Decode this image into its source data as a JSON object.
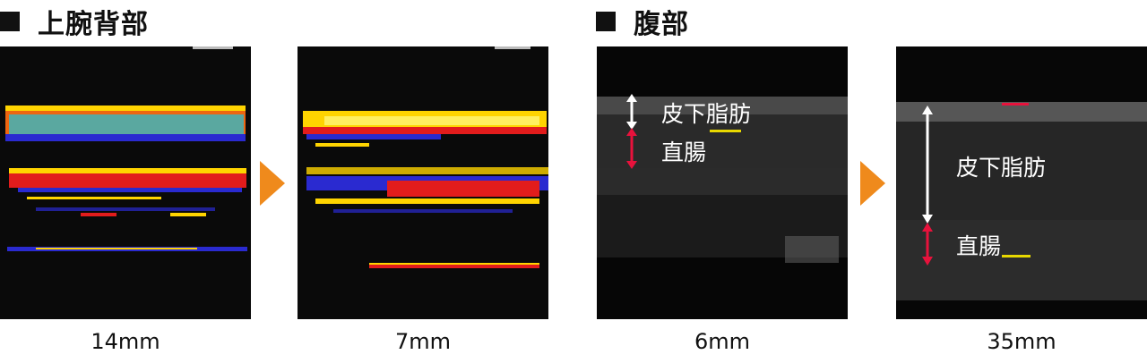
{
  "sections": {
    "upper_back": {
      "title": "上腕背部"
    },
    "abdomen": {
      "title": "腹部"
    }
  },
  "panels": [
    {
      "caption": "14mm"
    },
    {
      "caption": "7mm"
    },
    {
      "caption": "6mm",
      "labels": {
        "fat": "皮下脂肪",
        "muscle": "直腸"
      }
    },
    {
      "caption": "35mm",
      "labels": {
        "fat": "皮下脂肪",
        "muscle": "直腸"
      }
    }
  ],
  "colors": {
    "arrow": "#ef8a1c",
    "fat_marker": "#ffffff",
    "muscle_marker": "#e8123c"
  }
}
